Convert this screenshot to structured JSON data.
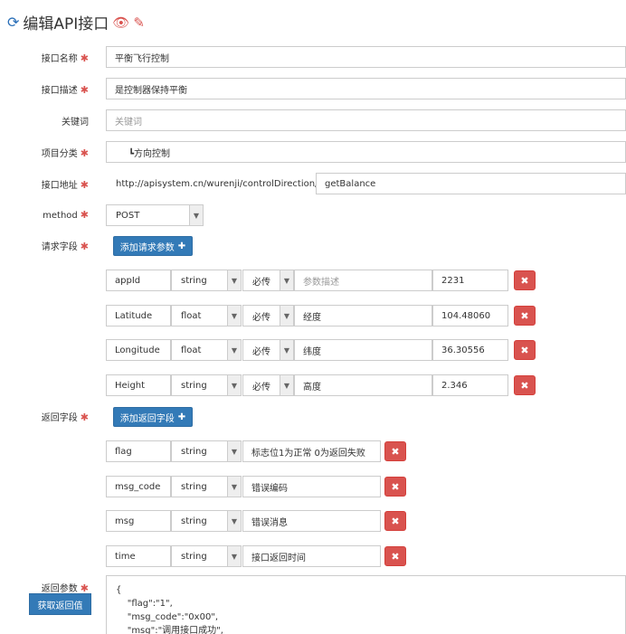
{
  "header": {
    "title": "编辑API接口",
    "refresh_icon": "refresh-icon",
    "eye_icon": "eye-icon",
    "edit_icon": "pencil-icon"
  },
  "form": {
    "name": {
      "label": "接口名称",
      "value": "平衡飞行控制"
    },
    "desc": {
      "label": "接口描述",
      "value": "是控制器保持平衡"
    },
    "keyword": {
      "label": "关键词",
      "placeholder": "关键词"
    },
    "category": {
      "label": "项目分类",
      "value": "┗方向控制"
    },
    "address": {
      "label": "接口地址",
      "prefix": "http://apisystem.cn/wurenji/controlDirection/",
      "value": "getBalance"
    },
    "method": {
      "label": "method",
      "value": "POST"
    },
    "request": {
      "label": "请求字段",
      "add_label": "添加请求参数",
      "rows": [
        {
          "name": "appId",
          "type": "string",
          "required": "必传",
          "desc": "",
          "desc_placeholder": "参数描述",
          "value": "2231"
        },
        {
          "name": "Latitude",
          "type": "float",
          "required": "必传",
          "desc": "经度",
          "value": "104.48060"
        },
        {
          "name": "Longitude",
          "type": "float",
          "required": "必传",
          "desc": "纬度",
          "value": "36.30556"
        },
        {
          "name": "Height",
          "type": "string",
          "required": "必传",
          "desc": "高度",
          "value": "2.346"
        }
      ]
    },
    "response": {
      "label": "返回字段",
      "add_label": "添加返回字段",
      "rows": [
        {
          "name": "flag",
          "type": "string",
          "desc": "标志位1为正常  0为返回失败"
        },
        {
          "name": "msg_code",
          "type": "string",
          "desc": "错误编码"
        },
        {
          "name": "msg",
          "type": "string",
          "desc": "错误消息"
        },
        {
          "name": "time",
          "type": "string",
          "desc": "接口返回时间"
        }
      ]
    },
    "return_params": {
      "label": "返回参数",
      "fetch_label": "获取返回值",
      "text": "{\n    \"flag\":\"1\",\n    \"msg_code\":\"0x00\",\n    \"msg\":\"调用接口成功\","
    }
  },
  "icons": {
    "add": "plus-icon",
    "delete": "close-icon",
    "dropdown": "chevron-down-icon"
  }
}
